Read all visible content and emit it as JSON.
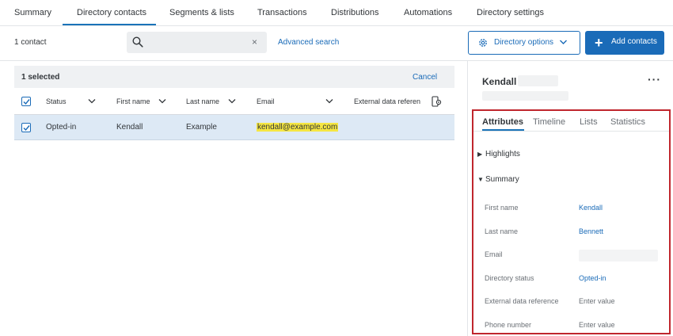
{
  "nav": {
    "tabs": [
      "Summary",
      "Directory contacts",
      "Segments & lists",
      "Transactions",
      "Distributions",
      "Automations",
      "Directory settings"
    ]
  },
  "toolbar": {
    "count": "1 contact",
    "search_value": "",
    "advanced_search": "Advanced search",
    "directory_options": "Directory options",
    "add_contacts": "Add contacts"
  },
  "table": {
    "selected_text": "1 selected",
    "cancel": "Cancel",
    "columns": [
      "Status",
      "First name",
      "Last name",
      "Email",
      "External data referen"
    ],
    "rows": [
      {
        "status": "Opted-in",
        "first_name": "Kendall",
        "last_name": "Example",
        "email": "kendall@example.com",
        "external": ""
      }
    ]
  },
  "panel": {
    "name": "Kendall",
    "tabs": [
      "Attributes",
      "Timeline",
      "Lists",
      "Statistics"
    ],
    "sections": {
      "highlights": "Highlights",
      "summary": "Summary"
    },
    "attributes": [
      {
        "label": "First name",
        "value": "Kendall"
      },
      {
        "label": "Last name",
        "value": "Bennett"
      },
      {
        "label": "Email",
        "value": ""
      },
      {
        "label": "Directory status",
        "value": "Opted-in"
      },
      {
        "label": "External data reference",
        "value": "Enter value"
      },
      {
        "label": "Phone number",
        "value": "Enter value"
      }
    ]
  },
  "colors": {
    "accent": "#1a6bb8",
    "highlight_box": "#c0262d",
    "email_highlight": "#f5e642"
  }
}
